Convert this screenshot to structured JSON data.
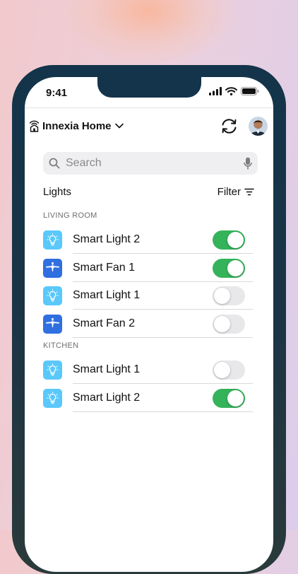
{
  "status_bar": {
    "time": "9:41"
  },
  "header": {
    "home_name": "Innexia Home"
  },
  "search": {
    "placeholder": "Search"
  },
  "section_title": "Lights",
  "filter_label": "Filter",
  "colors": {
    "toggle_on": "#34b35a",
    "light_icon_bg": "#5ac8fa",
    "fan_icon_bg": "#2f6fe0"
  },
  "rooms": [
    {
      "name": "LIVING ROOM",
      "devices": [
        {
          "name": "Smart Light 2",
          "icon": "lightbulb-icon",
          "on": true
        },
        {
          "name": "Smart Fan 1",
          "icon": "fan-icon",
          "on": true
        },
        {
          "name": "Smart Light 1",
          "icon": "lightbulb-icon",
          "on": false
        },
        {
          "name": "Smart Fan 2",
          "icon": "fan-icon",
          "on": false
        }
      ]
    },
    {
      "name": "KITCHEN",
      "devices": [
        {
          "name": "Smart Light 1",
          "icon": "lightbulb-icon",
          "on": false
        },
        {
          "name": "Smart Light 2",
          "icon": "lightbulb-icon",
          "on": true
        }
      ]
    }
  ]
}
